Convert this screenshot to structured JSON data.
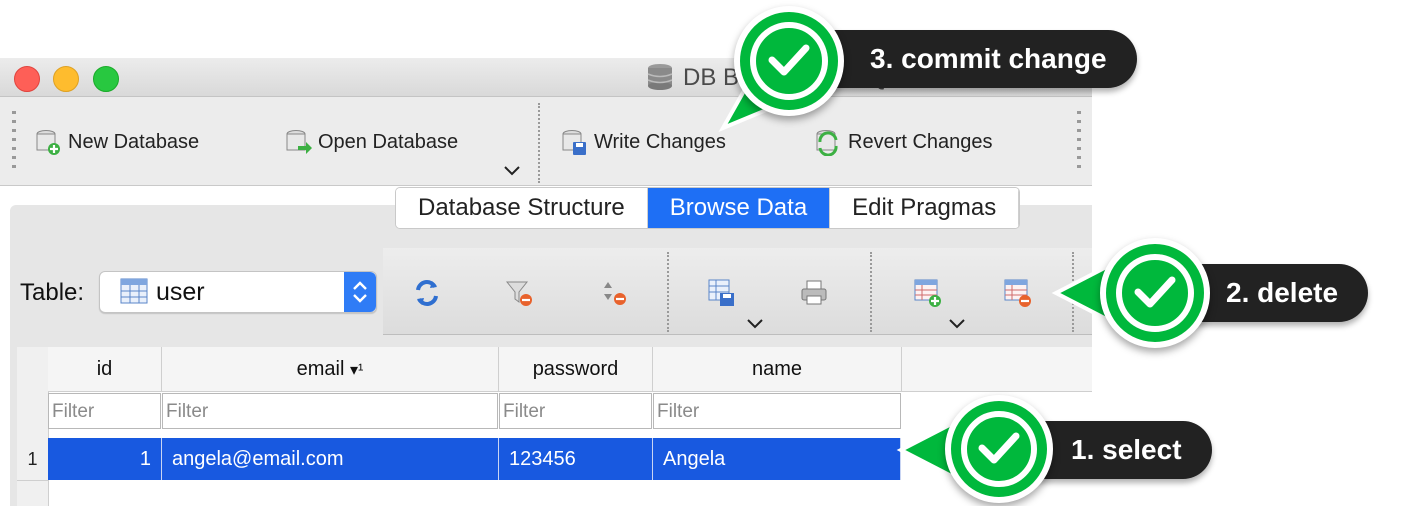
{
  "window": {
    "title": "DB Browser for SQLite - /Users/a",
    "traffic_lights": {
      "close": "#fe5f57",
      "minimize": "#febc2e",
      "zoom": "#28c840"
    }
  },
  "toolbar": {
    "new_database": "New Database",
    "open_database": "Open Database",
    "write_changes": "Write Changes",
    "revert_changes": "Revert Changes"
  },
  "tabs": [
    {
      "label": "Database Structure",
      "active": false
    },
    {
      "label": "Browse Data",
      "active": true
    },
    {
      "label": "Edit Pragmas",
      "active": false
    }
  ],
  "table_selector": {
    "label": "Table:",
    "value": "user"
  },
  "grid": {
    "columns": [
      "id",
      "email",
      "password",
      "name"
    ],
    "sort_indicator": "▾¹",
    "filter_placeholder": "Filter",
    "rows": [
      {
        "row_number": "1",
        "id": "1",
        "email": "angela@email.com",
        "password": "123456",
        "name": "Angela",
        "selected": true
      }
    ]
  },
  "callouts": [
    {
      "label": "3. commit change"
    },
    {
      "label": "2. delete"
    },
    {
      "label": "1. select"
    }
  ],
  "colors": {
    "accent": "#1e6ff5",
    "selection": "#1859e0",
    "badge": "#00b83c",
    "pill": "#222222"
  }
}
